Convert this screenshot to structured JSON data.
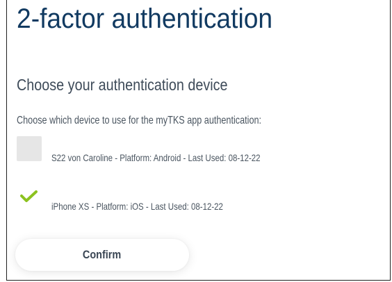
{
  "page": {
    "title": "2-factor authentication",
    "subtitle": "Choose your authentication device",
    "instruction": "Choose which device to use for the myTKS app authentication:"
  },
  "devices": [
    {
      "label": "S22 von Caroline - Platform: Android - Last Used: 08-12-22",
      "checked": false
    },
    {
      "label": "iPhone XS - Platform: iOS - Last Used: 08-12-22",
      "checked": true,
      "check_icon": "checkmark-icon"
    }
  ],
  "actions": {
    "confirm_label": "Confirm"
  },
  "colors": {
    "title": "#113a61",
    "text": "#4a5560",
    "checkmark": "#8cc21f",
    "checkbox_unchecked": "#e6e6e6"
  }
}
